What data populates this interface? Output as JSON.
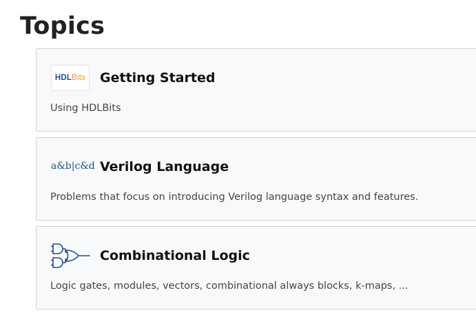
{
  "page": {
    "title": "Topics"
  },
  "topics": [
    {
      "title": "Getting Started",
      "description": "Using HDLBits",
      "icon": "hdlbits-logo",
      "logo": {
        "part1": "HDL",
        "part2": "Bits",
        "color1": "#1f4e8c",
        "color2": "#e8913a"
      }
    },
    {
      "title": "Verilog Language",
      "description": "Problems that focus on introducing Verilog language syntax and features.",
      "icon": "verilog-expression-logo",
      "logo": {
        "text": "a&b|c&d",
        "color": "#1f4e8c"
      }
    },
    {
      "title": "Combinational Logic",
      "description": "Logic gates, modules, vectors, combinational always blocks, k-maps, ...",
      "icon": "logic-gates-icon"
    }
  ]
}
